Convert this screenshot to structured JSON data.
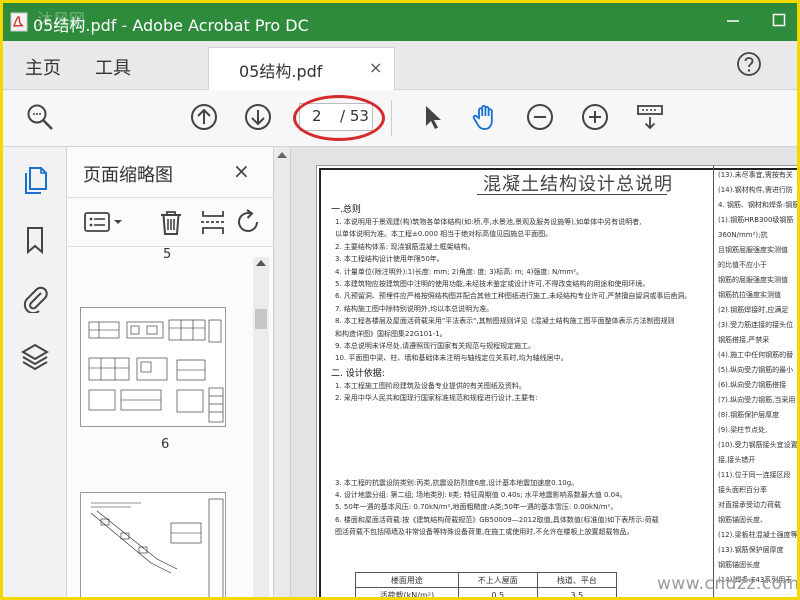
{
  "window": {
    "title": "05结构.pdf - Adobe Acrobat Pro DC",
    "watermark_tl": "沐风网",
    "controls": [
      "minimize",
      "maximize"
    ]
  },
  "menubar": {
    "home": "主页",
    "tools": "工具",
    "tab_label": "05结构.pdf",
    "tab_close": "×",
    "help": "help-icon"
  },
  "toolbar": {
    "current_page": "2",
    "total_pages": "/ 53",
    "icons": [
      "zoom-search-icon",
      "page-up-icon",
      "page-down-icon",
      "select-cursor-icon",
      "hand-tool-icon",
      "zoom-out-icon",
      "zoom-in-icon",
      "page-display-icon"
    ]
  },
  "colors": {
    "titlebar": "#2e8b3c",
    "hand_icon": "#1a6fd0",
    "highlight_ellipse": "#d42a2a",
    "frame_border": "#f5d800"
  },
  "left_rail": [
    "pages-icon",
    "bookmark-icon",
    "attachment-icon",
    "layers-icon"
  ],
  "thumbnail_panel": {
    "title": "页面缩略图",
    "close": "×",
    "tools": [
      "thumbnail-options-icon",
      "delete-icon",
      "insert-pages-icon",
      "rotate-icon"
    ],
    "partial_label": "5",
    "page_label": "6"
  },
  "document": {
    "title": "混凝土结构设计总说明",
    "sections": [
      "一.总则",
      "1. 本说明用于景观建(构)筑物各单体结构(如:桥,亭,水景池,景观及服务设施等),如单体中另有说明者,",
      "   以单体说明为准。本工程±0.000 相当于绝对标高值见园施总平面图。",
      "2. 主要结构体系:  现浇钢筋混凝土框架结构。",
      "3. 本工程结构设计使用年限50年。",
      "4. 计量单位(除注明外):1)长度: mm; 2)角度: 度; 3)标高: m; 4)强度: N/mm²。",
      "5. 本建筑物应按建筑图中注明的使用功能,未经技术鉴定或设计许可,不得改变结构的用途和使用环境。",
      "6. 凡预留洞、预埋件应严格按照结构图并配合其他工种图纸进行施工,未经结构专业许可,严禁擅自留洞或事后凿洞。",
      "7. 结构施工图中除特别说明外,均以本总说明为准。",
      "8. 本工程各楼层及屋面活荷载采用\"平法表示\",其制图规则详见《混凝土结构施工图平面整体表示方法制图规则",
      "   和构造详图》国标图集22G101-1。",
      "9. 本总说明未详尽处,请遵照现行国家有关规范与规程规定施工。",
      "10. 平面图中梁、柱、墙和基础体未注明与轴线定位关系时,均为轴线居中。",
      "二. 设计依据:",
      "1. 本工程施工图阶段建筑及设备专业提供的有关图纸及资料。",
      "2. 采用中华人民共和国现行国家标准规范和规程进行设计,主要有:",
      "3. 本工程的抗震设防类别:丙类,抗震设防烈度6度,设计基本地震加速度0.10g。",
      "4. 设计地震分组: 第二组; 场地类别: Ⅱ类; 特征周期值 0.40s; 水平地震影响系数最大值 0.04。",
      "5. 50年一遇的基本风压: 0.70kN/m²,地面粗糙度:A类;50年一遇的基本雪压: 0.00kN/m²。",
      "6. 楼面和屋面活荷载:按《建筑结构荷载规范》GB50009—2012取值,具体数值(标准值)如下表所示:荷载",
      "   图活荷载不包括隔墙及非常设备等特殊设备荷重,在施工或使用时,不允许在楼板上放置超载物品。"
    ],
    "right_column": [
      "(13).未尽事宜,需按有关",
      "(14).钢材构件,需进行防",
      "4. 钢筋、钢材和焊条:钢筋表",
      "(1).钢筋HRB300级钢筋",
      "   360N/mm²);抗",
      "   且钢筋屈服强度实测值",
      "   的比值不应小于",
      "   钢筋的屈服强度实测值",
      "   钢筋抗拉强度实测值",
      "(2).钢筋焊接时,应满足",
      "(3).受力筋连接的接头位",
      "   钢筋搭接,严禁采",
      "(4).施工中任何钢筋的替",
      "(5).纵向受力钢筋的最小",
      "(6).纵向受力钢筋搭接",
      "(7).纵向受力钢筋,当采用",
      "(8).钢筋保护层厚度",
      "(9).梁柱节点处,",
      "(10).受力钢筋接头宜设置在",
      "   接,接头错开",
      "(11).位于同一连接区段",
      "   接头面积百分率",
      "   对直接承受动力荷载",
      "   钢筋锚固长度、",
      "(12).梁板柱混凝土强度等级",
      "(13).钢筋保护层厚度",
      "   钢筋锚固长度",
      "(14).焊条:E43系列用于"
    ],
    "load_table": {
      "headers": [
        "楼面用途",
        "不上人屋面",
        "栈道、平台"
      ],
      "row": [
        "活荷载(kN/m²)",
        "0.5",
        "3.5"
      ]
    }
  },
  "site_watermark": "www.cndzz.com"
}
